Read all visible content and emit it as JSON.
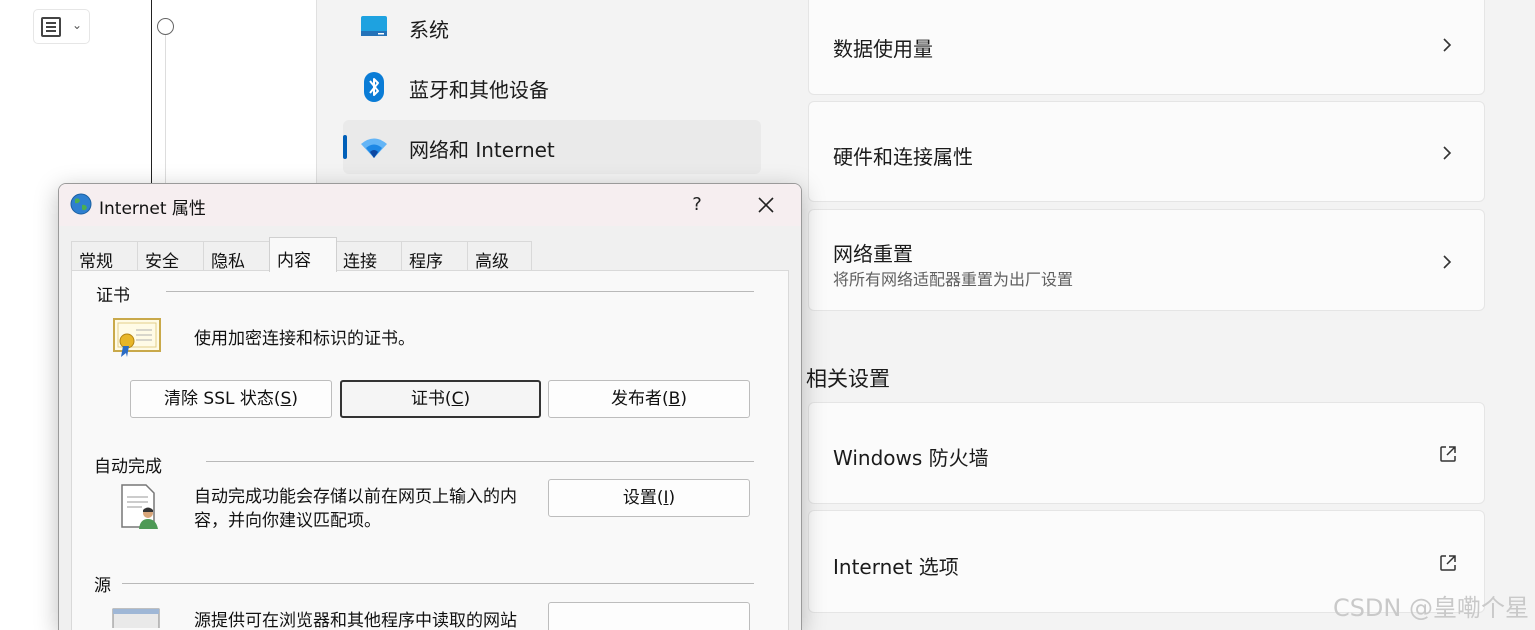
{
  "nav": {
    "items": [
      {
        "label": "系统",
        "icon": "monitor-icon",
        "top": 0
      },
      {
        "label": "蓝牙和其他设备",
        "icon": "bluetooth-icon"
      },
      {
        "label": "网络和 Internet",
        "icon": "wifi-icon",
        "active": true
      }
    ]
  },
  "settings": {
    "cards": [
      {
        "title": "数据使用量"
      },
      {
        "title": "硬件和连接属性"
      },
      {
        "title": "网络重置",
        "subtitle": "将所有网络适配器重置为出厂设置"
      }
    ],
    "related_heading": "相关设置",
    "related": [
      {
        "title": "Windows 防火墙"
      },
      {
        "title": "Internet 选项"
      }
    ]
  },
  "dialog": {
    "title": "Internet 属性",
    "help": "?",
    "tabs": [
      "常规",
      "安全",
      "隐私",
      "内容",
      "连接",
      "程序",
      "高级"
    ],
    "active_tab": "内容",
    "certificates": {
      "label": "证书",
      "description": "使用加密连接和标识的证书。",
      "buttons": {
        "clear_ssl": {
          "text": "清除 SSL 状态(",
          "key": "S",
          "end": ")"
        },
        "certificates": {
          "text": "证书(",
          "key": "C",
          "end": ")"
        },
        "publishers": {
          "text": "发布者(",
          "key": "B",
          "end": ")"
        }
      }
    },
    "autocomplete": {
      "label": "自动完成",
      "description_line1": "自动完成功能会存储以前在网页上输入的内",
      "description_line2": "容，并向你建议匹配项。",
      "settings_button": {
        "text": "设置(",
        "key": "I",
        "end": ")"
      }
    },
    "feeds": {
      "label": "源",
      "description_partial": "源提供可在浏览器和其他程序中读取的网站"
    }
  },
  "watermark": "CSDN @皇嘞个星",
  "colors": {
    "accent": "#005fb8",
    "panel": "#f3f3f3",
    "card": "#fbfbfb",
    "dialog_bg": "#f0f0f0"
  }
}
